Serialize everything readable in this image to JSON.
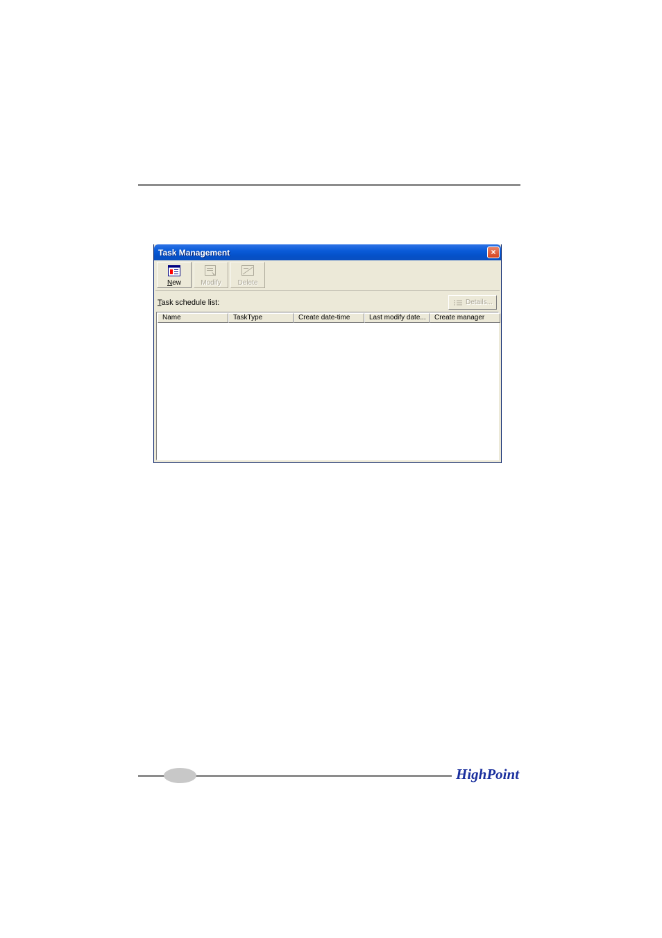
{
  "window": {
    "title": "Task Management",
    "close_glyph": "×"
  },
  "toolbar": {
    "new_label_accel": "N",
    "new_label_rest": "ew",
    "modify_label": "Modify",
    "delete_label": "Delete"
  },
  "list": {
    "label_accel": "T",
    "label_rest": "ask schedule list:",
    "details_label": "Details...",
    "columns": [
      "Name",
      "TaskType",
      "Create date-time",
      "Last modify date...",
      "Create manager"
    ]
  },
  "logo": {
    "text": "HighPoint"
  },
  "colors": {
    "title_blue": "#0a5bd8",
    "close_red": "#d6431e",
    "dialog_bg": "#ece9d8"
  },
  "icons": [
    "new-task-icon",
    "modify-task-icon",
    "delete-task-icon",
    "details-list-icon",
    "close-icon"
  ]
}
